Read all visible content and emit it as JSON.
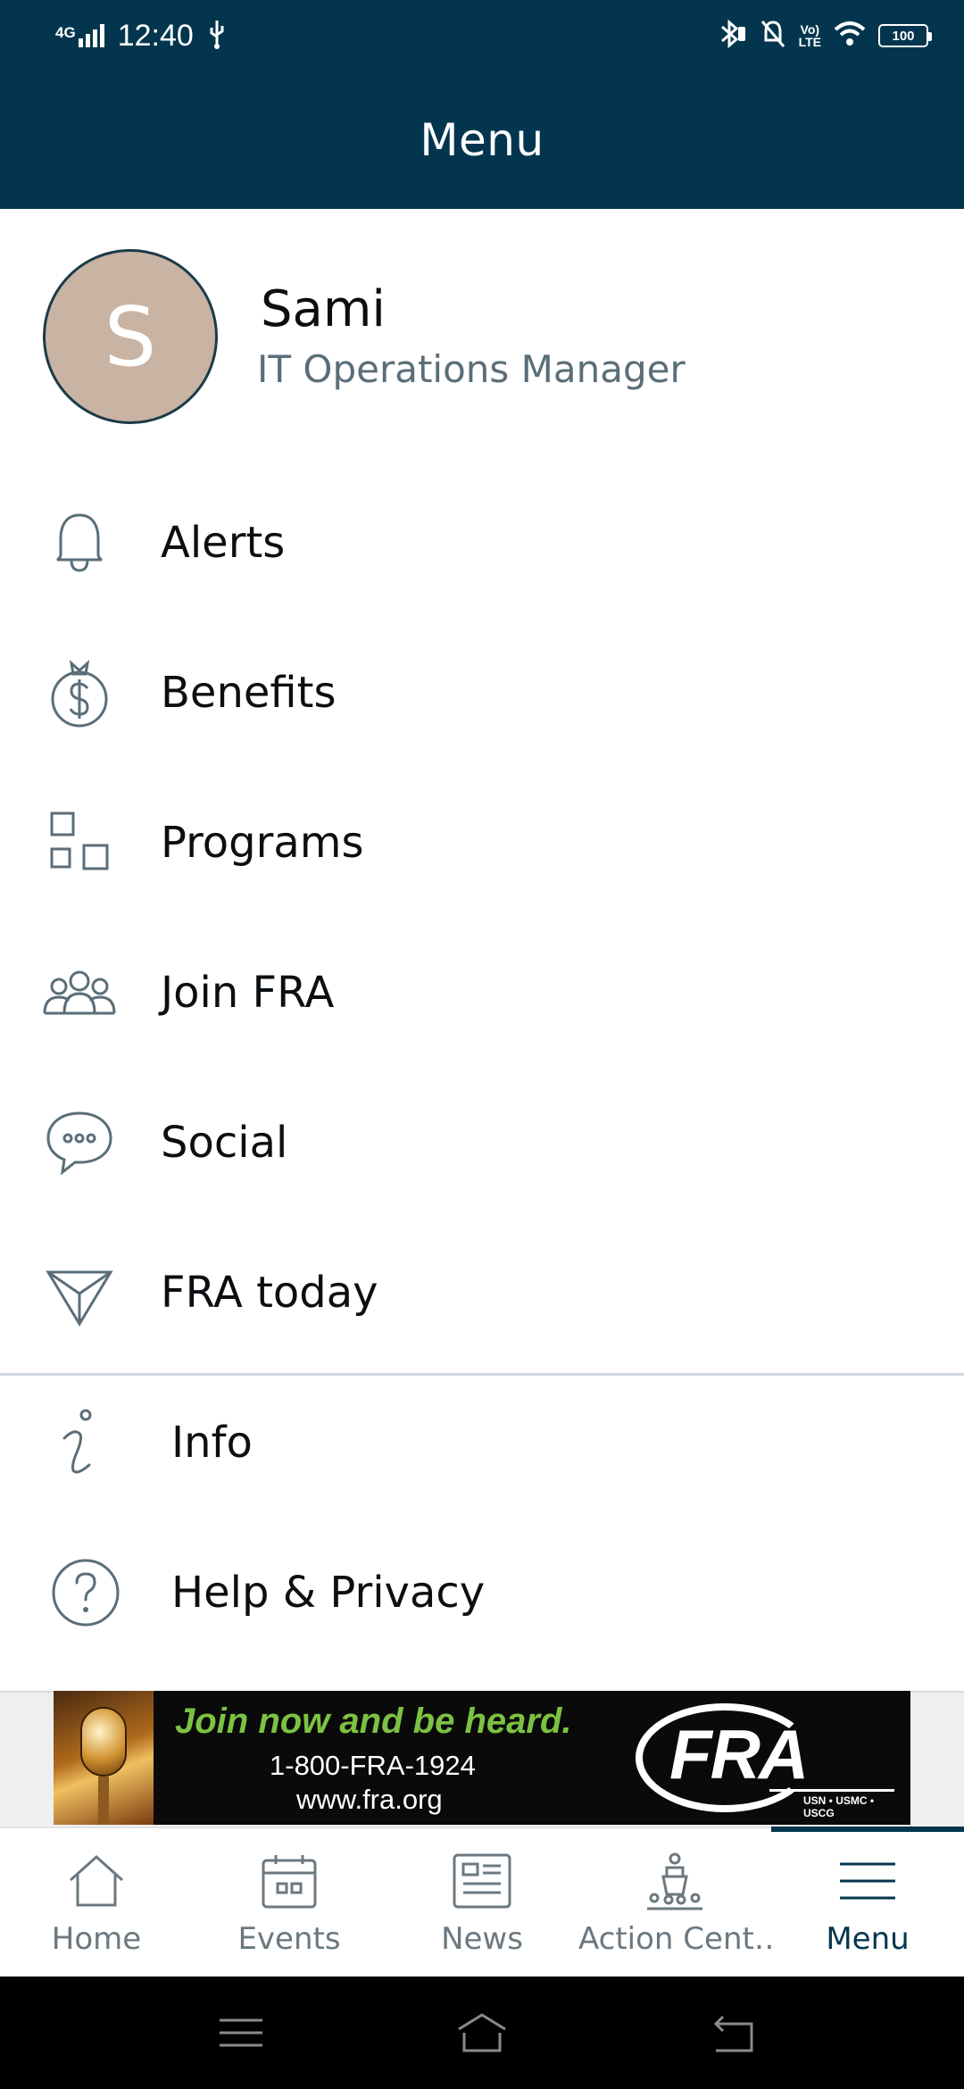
{
  "status_bar": {
    "network": "4G",
    "time": "12:40",
    "battery": "100",
    "icons": [
      "signal-icon",
      "usb-icon",
      "bluetooth-icon",
      "mute-icon",
      "volte-icon",
      "wifi-icon",
      "battery-icon"
    ]
  },
  "header": {
    "title": "Menu"
  },
  "profile": {
    "initial": "S",
    "name": "Sami",
    "role": "IT Operations Manager"
  },
  "menu": {
    "primary": [
      {
        "label": "Alerts",
        "icon": "bell-icon"
      },
      {
        "label": "Benefits",
        "icon": "money-bag-icon"
      },
      {
        "label": "Programs",
        "icon": "grid-icon"
      },
      {
        "label": "Join FRA",
        "icon": "people-icon"
      },
      {
        "label": "Social",
        "icon": "chat-bubble-icon"
      },
      {
        "label": "FRA today",
        "icon": "send-icon"
      }
    ],
    "secondary": [
      {
        "label": "Info",
        "icon": "info-icon"
      },
      {
        "label": "Help & Privacy",
        "icon": "help-icon"
      }
    ]
  },
  "ad": {
    "tagline": "Join now and be heard.",
    "phone": "1-800-FRA-1924",
    "url": "www.fra.org",
    "logo": "FRA",
    "logo_sub": "USN • USMC • USCG"
  },
  "bottom_nav": [
    {
      "label": "Home",
      "icon": "home-icon",
      "active": false
    },
    {
      "label": "Events",
      "icon": "calendar-icon",
      "active": false
    },
    {
      "label": "News",
      "icon": "newspaper-icon",
      "active": false
    },
    {
      "label": "Action Cent…",
      "icon": "podium-icon",
      "active": false
    },
    {
      "label": "Menu",
      "icon": "hamburger-icon",
      "active": true
    }
  ],
  "colors": {
    "header_bg": "#03364e",
    "avatar_bg": "#c9b3a3",
    "icon_stroke": "#5a6e79",
    "ad_green": "#7cc242"
  }
}
